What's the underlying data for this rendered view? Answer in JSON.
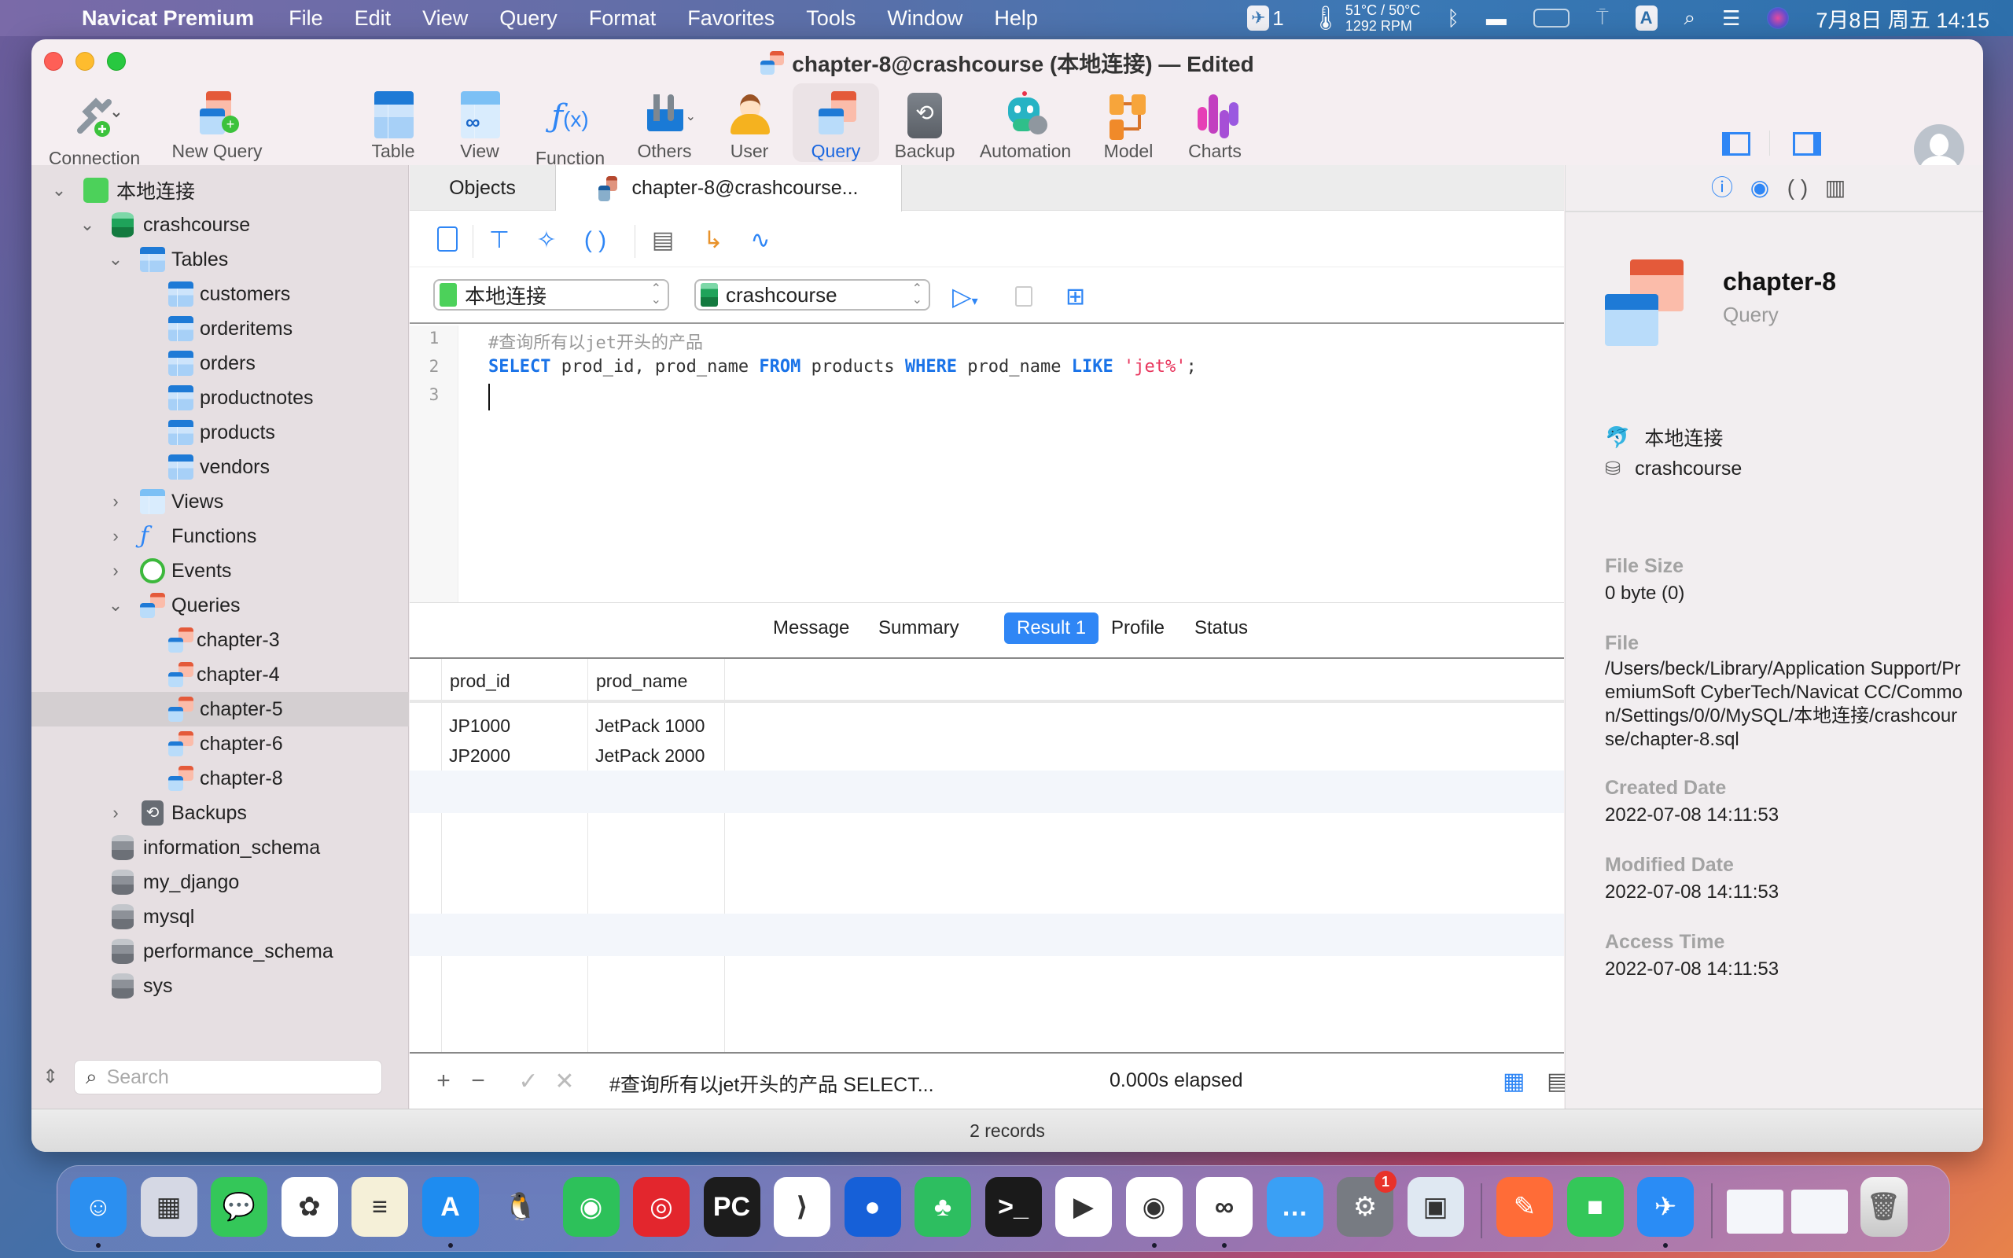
{
  "menubar": {
    "app_name": "Navicat Premium",
    "items": [
      "File",
      "Edit",
      "View",
      "Query",
      "Format",
      "Favorites",
      "Tools",
      "Window",
      "Help"
    ],
    "status": {
      "notif_count": "1",
      "temp": "51°C / 50°C",
      "fan": "1292 RPM",
      "input_method": "A",
      "datetime": "7月8日 周五  14:15"
    }
  },
  "window": {
    "title": "chapter-8@crashcourse (本地连接) — Edited"
  },
  "toolbar": {
    "buttons": [
      {
        "label": "Connection",
        "icon": "connection-icon"
      },
      {
        "label": "New Query",
        "icon": "new-query-icon"
      },
      {
        "label": "Table",
        "icon": "table-icon"
      },
      {
        "label": "View",
        "icon": "view-icon"
      },
      {
        "label": "Function",
        "icon": "function-icon"
      },
      {
        "label": "Others",
        "icon": "others-icon"
      },
      {
        "label": "User",
        "icon": "user-icon"
      },
      {
        "label": "Query",
        "icon": "query-icon",
        "active": true
      },
      {
        "label": "Backup",
        "icon": "backup-icon"
      },
      {
        "label": "Automation",
        "icon": "automation-icon"
      },
      {
        "label": "Model",
        "icon": "model-icon"
      },
      {
        "label": "Charts",
        "icon": "charts-icon"
      }
    ],
    "view_label": "View"
  },
  "sidebar": {
    "connection": "本地连接",
    "database": "crashcourse",
    "tables_label": "Tables",
    "tables": [
      "customers",
      "orderitems",
      "orders",
      "productnotes",
      "products",
      "vendors"
    ],
    "views_label": "Views",
    "functions_label": "Functions",
    "events_label": "Events",
    "queries_label": "Queries",
    "queries": [
      "chapter-3",
      "chapter-4",
      "chapter-5",
      "chapter-6",
      "chapter-8"
    ],
    "selected_query": "chapter-5",
    "backups_label": "Backups",
    "other_databases": [
      "information_schema",
      "my_django",
      "mysql",
      "performance_schema",
      "sys"
    ],
    "search_placeholder": "Search"
  },
  "main": {
    "tabs": [
      {
        "label": "Objects"
      },
      {
        "label": "chapter-8@crashcourse...",
        "active": true
      }
    ],
    "connection_select": "本地连接",
    "database_select": "crashcourse",
    "code": {
      "line_numbers": [
        "1",
        "2",
        "3"
      ],
      "comment": "#查询所有以jet开头的产品",
      "kw_select": "SELECT",
      "cols": " prod_id, prod_name ",
      "kw_from": "FROM",
      "table": " products ",
      "kw_where": "WHERE",
      "col": " prod_name ",
      "kw_like": "LIKE",
      "pattern": " 'jet%'",
      "end": ";"
    },
    "result_tabs": [
      "Message",
      "Summary",
      "Result 1",
      "Profile",
      "Status"
    ],
    "active_result_tab": "Result 1",
    "grid": {
      "columns": [
        "prod_id",
        "prod_name"
      ],
      "rows": [
        [
          "JP1000",
          "JetPack 1000"
        ],
        [
          "JP2000",
          "JetPack 2000"
        ]
      ]
    },
    "footer": {
      "query_summary": "#查询所有以jet开头的产品  SELECT...",
      "elapsed": "0.000s elapsed"
    }
  },
  "info": {
    "name": "chapter-8",
    "type": "Query",
    "connection": "本地连接",
    "database": "crashcourse",
    "fields": [
      {
        "label": "File Size",
        "value": "0 byte (0)"
      },
      {
        "label": "File",
        "value": "/Users/beck/Library/Application Support/PremiumSoft CyberTech/Navicat CC/Common/Settings/0/0/MySQL/本地连接/crashcourse/chapter-8.sql"
      },
      {
        "label": "Created Date",
        "value": "2022-07-08 14:11:53"
      },
      {
        "label": "Modified Date",
        "value": "2022-07-08 14:11:53"
      },
      {
        "label": "Access Time",
        "value": "2022-07-08 14:11:53"
      }
    ]
  },
  "statusbar": {
    "records": "2 records"
  },
  "dock": {
    "apps": [
      {
        "name": "Finder",
        "color": "#2b8ff0",
        "glyph": "☺",
        "running": true
      },
      {
        "name": "Launchpad",
        "color": "#d5d8e4",
        "glyph": "▦",
        "running": false
      },
      {
        "name": "Messages",
        "color": "#34c759",
        "glyph": "💬",
        "running": false
      },
      {
        "name": "Photos",
        "color": "#ffffff",
        "glyph": "✿",
        "running": false
      },
      {
        "name": "Notes",
        "color": "#f5f0d8",
        "glyph": "≡",
        "running": false
      },
      {
        "name": "App Store",
        "color": "#1e8cf0",
        "glyph": "A",
        "running": true
      },
      {
        "name": "QQ",
        "color": "transparent",
        "glyph": "🐧",
        "running": false
      },
      {
        "name": "WeChat",
        "color": "#2dc15a",
        "glyph": "◉",
        "running": false
      },
      {
        "name": "NetEase Music",
        "color": "#e3262d",
        "glyph": "◎",
        "running": false
      },
      {
        "name": "PyCharm",
        "color": "#1c1c1c",
        "glyph": "PC",
        "running": false
      },
      {
        "name": "VS Code",
        "color": "#ffffff",
        "glyph": "⟩",
        "running": false
      },
      {
        "name": "Location App",
        "color": "#1660d8",
        "glyph": "●",
        "running": false
      },
      {
        "name": "Evernote",
        "color": "#2dbe60",
        "glyph": "♣",
        "running": false
      },
      {
        "name": "Terminal",
        "color": "#1a1a1a",
        "glyph": ">_",
        "running": false
      },
      {
        "name": "Video Player",
        "color": "#ffffff",
        "glyph": "▶",
        "running": false
      },
      {
        "name": "Chrome",
        "color": "#ffffff",
        "glyph": "◉",
        "running": true
      },
      {
        "name": "Navicat",
        "color": "#ffffff",
        "glyph": "∞",
        "running": true
      },
      {
        "name": "Chat App",
        "color": "#3aa0f5",
        "glyph": "…",
        "running": false
      },
      {
        "name": "System Preferences",
        "color": "#777b82",
        "glyph": "⚙",
        "running": false,
        "badge": "1"
      },
      {
        "name": "Preview",
        "color": "#dfe8f2",
        "glyph": "▣",
        "running": false
      },
      {
        "name": "Postman",
        "color": "#ff6c37",
        "glyph": "✎",
        "running": false
      },
      {
        "name": "FaceTime",
        "color": "#34c759",
        "glyph": "■",
        "running": false
      },
      {
        "name": "Feishu",
        "color": "#2a8cf5",
        "glyph": "✈",
        "running": true
      }
    ]
  }
}
